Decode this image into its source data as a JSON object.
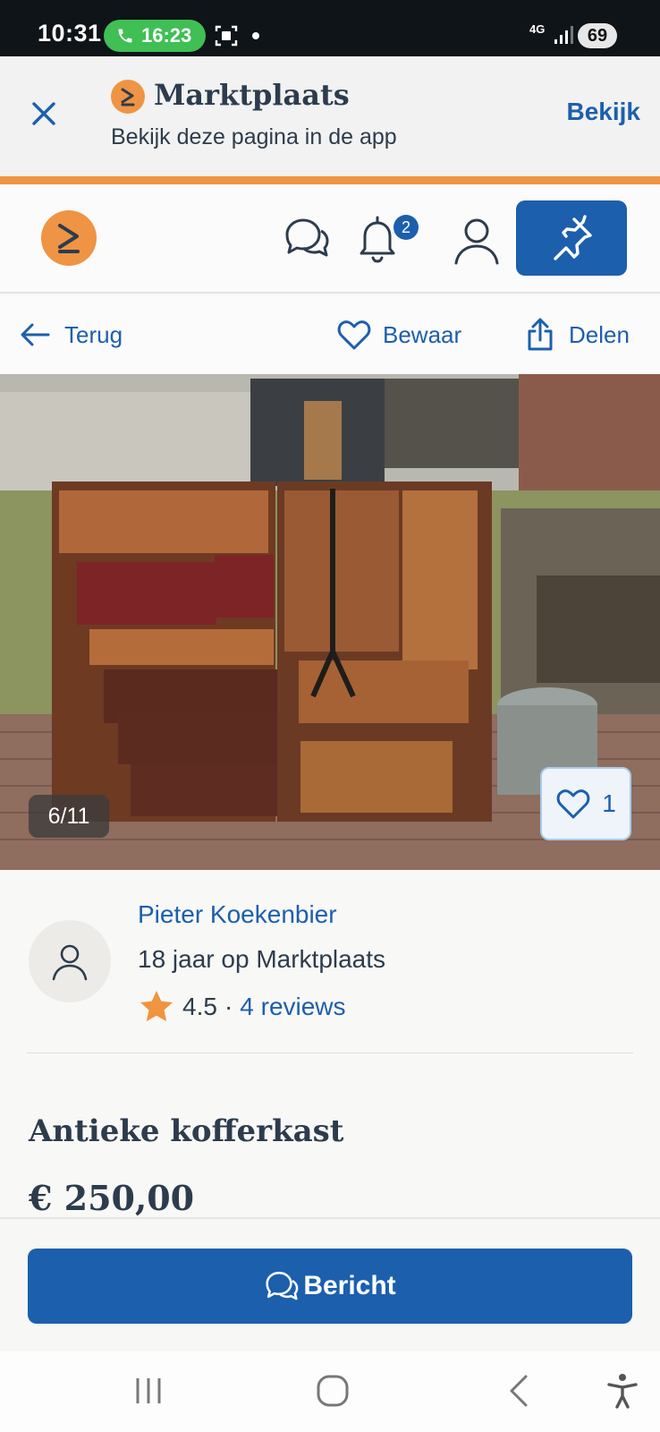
{
  "status_bar": {
    "time": "10:31",
    "call_duration": "16:23",
    "network": "4G",
    "battery": "69"
  },
  "app_banner": {
    "app_name": "Marktplaats",
    "subtitle": "Bekijk deze pagina in de app",
    "open_label": "Bekijk"
  },
  "top_nav": {
    "notification_count": "2"
  },
  "action_bar": {
    "back_label": "Terug",
    "save_label": "Bewaar",
    "share_label": "Delen"
  },
  "photo": {
    "counter": "6/11",
    "favorites_count": "1"
  },
  "seller": {
    "name": "Pieter Koekenbier",
    "membership": "18 jaar op Marktplaats",
    "rating": "4.5",
    "separator": "·",
    "reviews": "4 reviews"
  },
  "listing": {
    "title": "Antieke kofferkast",
    "price": "€ 250,00"
  },
  "cta": {
    "message_label": "Bericht"
  },
  "colors": {
    "brand_blue": "#1c5fad",
    "brand_orange": "#ee9444",
    "text_dark": "#2d3c4d",
    "star": "#f0943f"
  }
}
